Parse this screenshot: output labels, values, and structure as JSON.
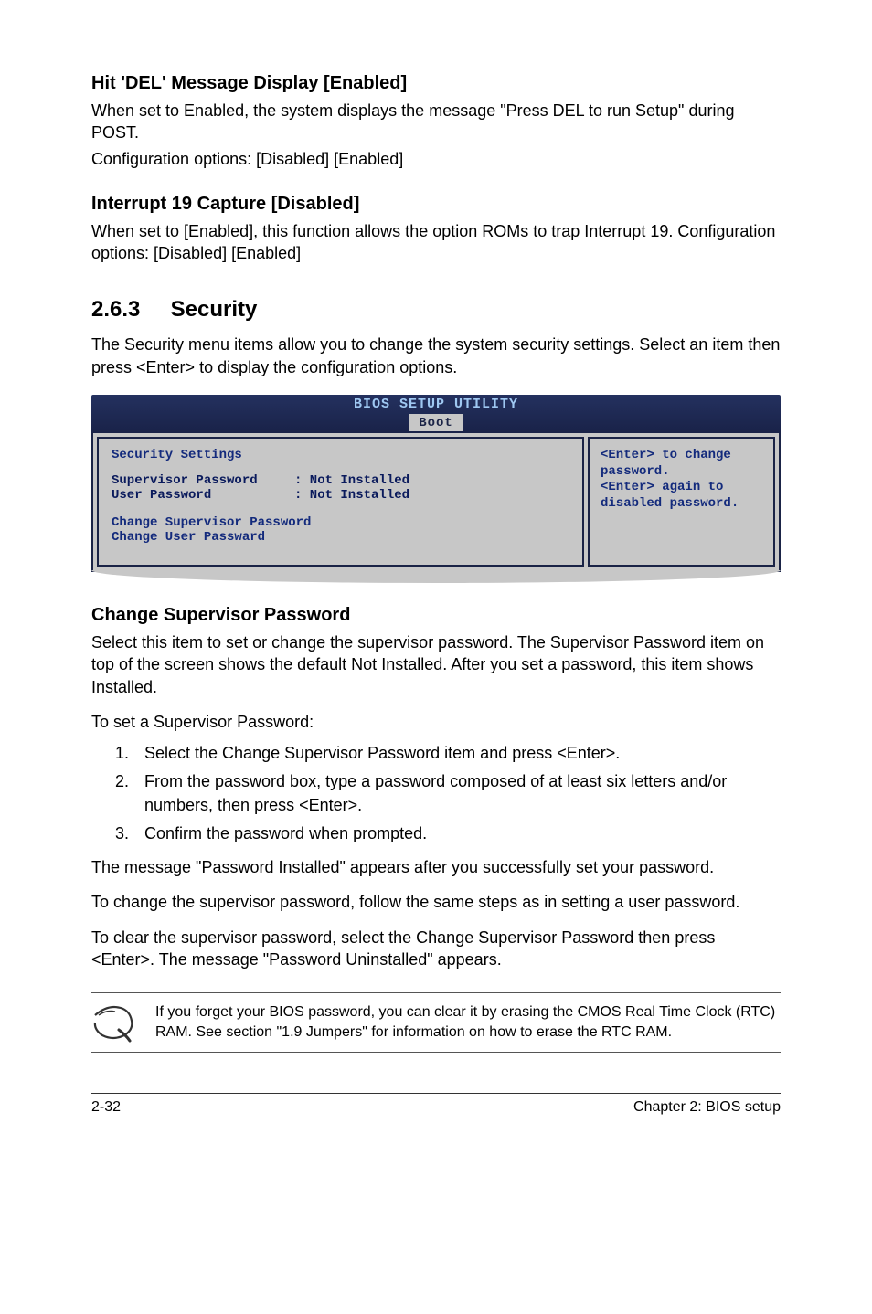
{
  "section1": {
    "heading": "Hit 'DEL' Message Display [Enabled]",
    "p1": "When set to Enabled, the system displays the message \"Press DEL to run Setup\" during POST.",
    "p2": "Configuration options: [Disabled] [Enabled]"
  },
  "section2": {
    "heading": "Interrupt 19 Capture [Disabled]",
    "p1": "When set to [Enabled], this function allows the option ROMs to trap Interrupt 19. Configuration options: [Disabled] [Enabled]"
  },
  "section3": {
    "num": "2.6.3",
    "title": "Security",
    "intro": "The Security menu items allow you to change the system security settings. Select an item then press <Enter> to display the configuration options."
  },
  "bios": {
    "title": "BIOS SETUP UTILITY",
    "tab": "Boot",
    "left": {
      "heading": "Security Settings",
      "rows": [
        {
          "label": "Supervisor Password",
          "value": ": Not Installed"
        },
        {
          "label": "User Password",
          "value": ": Not Installed"
        }
      ],
      "actions": [
        "Change Supervisor Password",
        "Change User Passward"
      ]
    },
    "help": "<Enter> to change password.\n<Enter> again to disabled password."
  },
  "section4": {
    "heading": "Change Supervisor Password",
    "p1": "Select this item to set or change the supervisor password. The Supervisor Password item on top of the screen shows the default Not Installed. After you set a password, this item shows Installed.",
    "p2": "To set a Supervisor Password:",
    "steps": [
      "Select the Change Supervisor Password item and press <Enter>.",
      "From the password box, type a password composed of at least six letters and/or numbers, then press <Enter>.",
      "Confirm the password when prompted."
    ],
    "p3": "The message \"Password Installed\" appears after you successfully set your password.",
    "p4": "To change the supervisor password, follow the same steps as in setting a user password.",
    "p5": "To clear the supervisor password, select the Change Supervisor Password then press <Enter>. The message \"Password Uninstalled\" appears."
  },
  "note": {
    "text": "If you forget your BIOS password, you can clear it by erasing the CMOS Real Time Clock (RTC) RAM. See section \"1.9 Jumpers\" for information on how to erase the RTC RAM."
  },
  "footer": {
    "left": "2-32",
    "right": "Chapter 2: BIOS setup"
  }
}
